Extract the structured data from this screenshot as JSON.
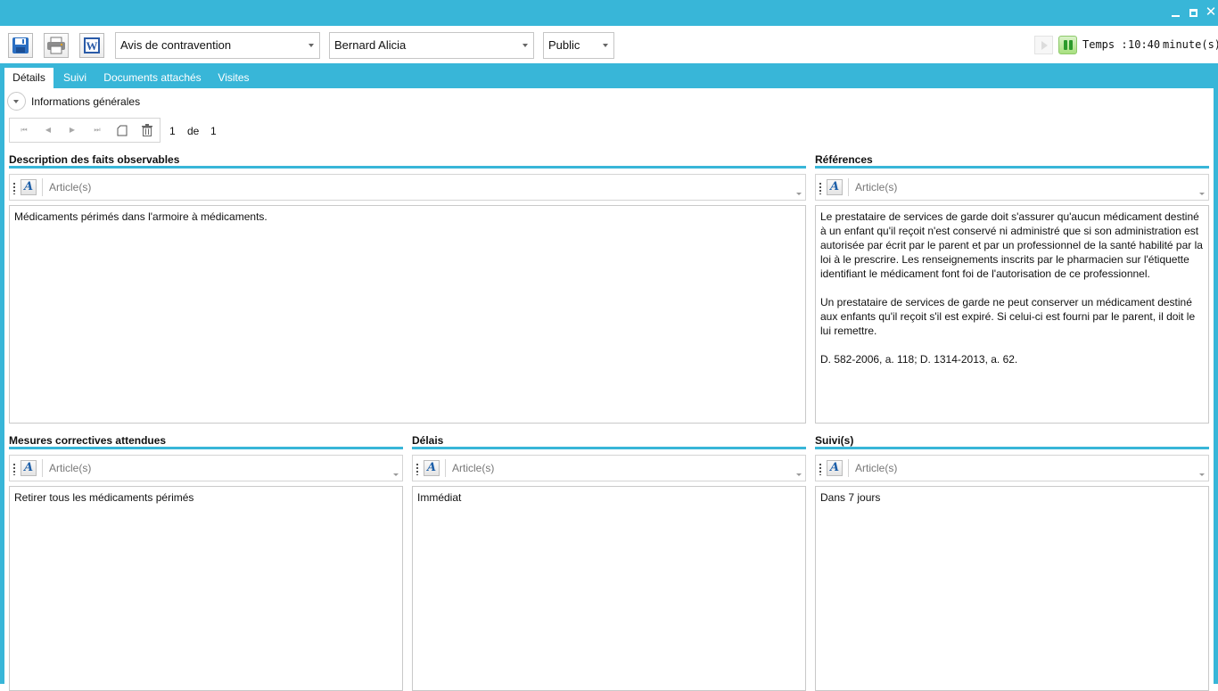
{
  "window": {
    "accent_color": "#38b6d8"
  },
  "toolbar": {
    "document_type": "Avis de contravention",
    "person": "Bernard Alicia",
    "visibility": "Public",
    "timer_label": "Temps :",
    "timer_value": "10:40",
    "timer_unit": "minute(s)"
  },
  "tabs": [
    {
      "label": "Détails",
      "active": true
    },
    {
      "label": "Suivi",
      "active": false
    },
    {
      "label": "Documents attachés",
      "active": false
    },
    {
      "label": "Visites",
      "active": false
    }
  ],
  "section": {
    "title": "Informations générales"
  },
  "navigator": {
    "current": "1",
    "of_label": "de",
    "total": "1"
  },
  "groups": {
    "description": {
      "title": "Description des faits observables",
      "placeholder": "Article(s)",
      "text": [
        "Médicaments périmés dans l'armoire à médicaments."
      ]
    },
    "references": {
      "title": "Références",
      "placeholder": "Article(s)",
      "text": [
        "Le prestataire de services de garde doit s'assurer qu'aucun médicament destiné à un enfant qu'il reçoit n'est conservé ni administré que si son administration est autorisée par écrit par le parent et par un professionnel de la santé habilité par la loi à le prescrire. Les renseignements inscrits par le pharmacien sur l'étiquette identifiant le médicament font foi de l'autorisation de ce professionnel.",
        "Un prestataire de services de garde ne peut conserver un médicament destiné aux enfants qu'il reçoit s'il est expiré. Si celui-ci est fourni par le parent, il doit le lui remettre.",
        "D. 582-2006, a. 118; D. 1314-2013, a. 62."
      ]
    },
    "corrective": {
      "title": "Mesures correctives attendues",
      "placeholder": "Article(s)",
      "text": [
        "Retirer tous les médicaments périmés"
      ]
    },
    "delays": {
      "title": "Délais",
      "placeholder": "Article(s)",
      "text": [
        "Immédiat"
      ]
    },
    "followups": {
      "title": "Suivi(s)",
      "placeholder": "Article(s)",
      "text": [
        "Dans 7 jours"
      ]
    }
  },
  "icons": [
    "save-icon",
    "print-icon",
    "word-icon",
    "play-icon",
    "pause-icon",
    "minimize-icon",
    "maximize-icon",
    "close-icon",
    "first-record-icon",
    "previous-record-icon",
    "next-record-icon",
    "last-record-icon",
    "new-record-icon",
    "delete-icon",
    "expand-icon",
    "article-style-icon"
  ]
}
